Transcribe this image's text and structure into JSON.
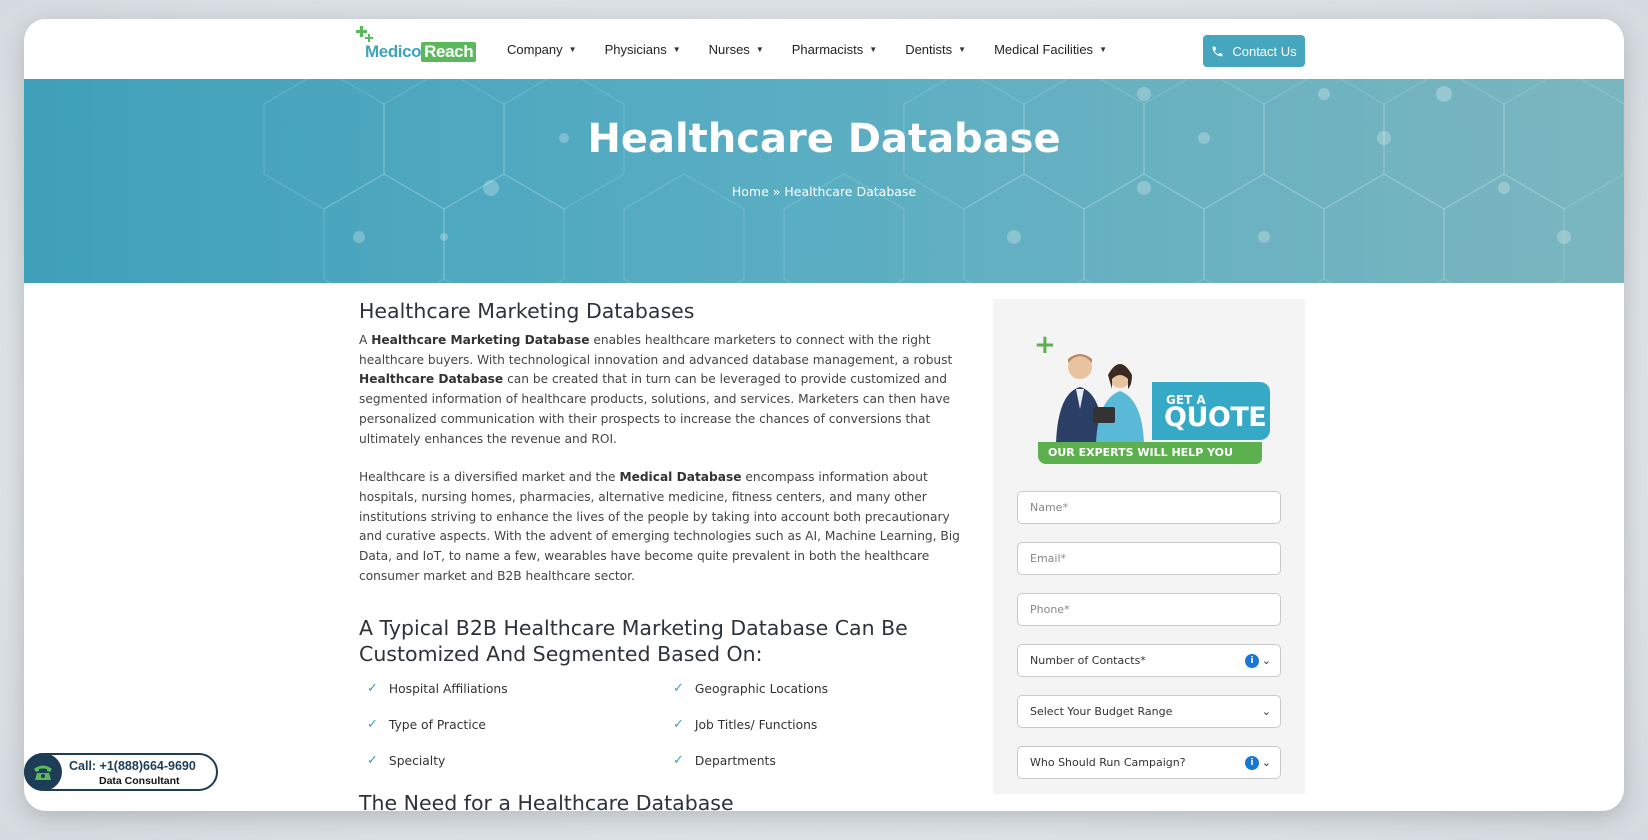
{
  "brand": {
    "part1": "Medico",
    "part2": "Reach",
    "green": "#5cb85c",
    "teal": "#3fa3bd"
  },
  "nav": {
    "items": [
      {
        "label": "Company"
      },
      {
        "label": "Physicians"
      },
      {
        "label": "Nurses"
      },
      {
        "label": "Pharmacists"
      },
      {
        "label": "Dentists"
      },
      {
        "label": "Medical Facilities"
      }
    ],
    "contact_label": "Contact Us"
  },
  "hero": {
    "title": "Healthcare Database",
    "breadcrumb": "Home » Healthcare Database"
  },
  "content": {
    "heading1": "Healthcare Marketing Databases",
    "p1": {
      "t1": "A ",
      "b1": "Healthcare Marketing Database",
      "t2": " enables healthcare marketers to connect with the right healthcare buyers. With technological innovation and advanced database management, a robust ",
      "b2": "Healthcare Database",
      "t3": " can be created that in turn can be leveraged to provide customized and segmented information of healthcare products, solutions, and services. Marketers can then have personalized communication with their prospects to increase the chances of conversions that ultimately enhances the revenue and ROI."
    },
    "p2": {
      "t1": "Healthcare is a diversified market and the ",
      "b1": "Medical Database",
      "t2": " encompass information about hospitals, nursing homes, pharmacies, alternative medicine, fitness centers, and many other institutions striving to enhance the lives of the people by taking into account both precautionary and curative aspects. With the advent of emerging technologies such as AI, Machine Learning, Big Data, and IoT, to name a few, wearables have become quite prevalent in both the healthcare consumer market and B2B healthcare sector."
    },
    "heading2": "A Typical B2B Healthcare Marketing Database Can Be Customized And Segmented Based On:",
    "features": [
      "Hospital Affiliations",
      "Geographic Locations",
      "Type of Practice",
      "Job Titles/ Functions",
      "Specialty",
      "Departments"
    ],
    "heading3": "The Need for a Healthcare Database"
  },
  "quote": {
    "get": "GET A",
    "big": "QUOTE",
    "strip": "OUR EXPERTS WILL HELP YOU"
  },
  "form": {
    "name_placeholder": "Name*",
    "email_placeholder": "Email*",
    "phone_placeholder": "Phone*",
    "contacts_select": "Number of Contacts*",
    "budget_select": "Select Your Budget Range",
    "campaign_select": "Who Should Run Campaign?"
  },
  "call": {
    "number": "Call: +1(888)664-9690",
    "sub": "Data Consultant"
  }
}
